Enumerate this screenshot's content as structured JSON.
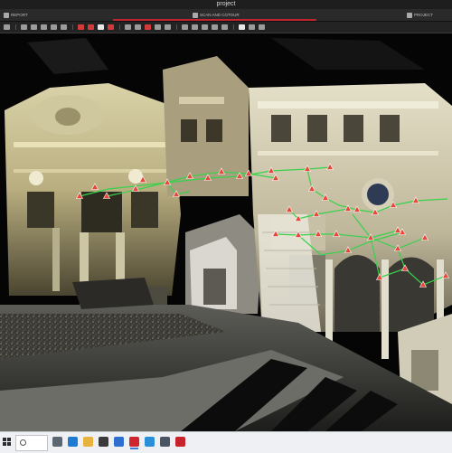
{
  "window": {
    "title": "project"
  },
  "tabs": [
    {
      "label": "REPORT",
      "icon": "document-icon"
    },
    {
      "label": "SCAN AND COTOUR",
      "icon": "scan-icon"
    },
    {
      "label": "PROJECT",
      "icon": "folder-icon"
    }
  ],
  "toolbar": {
    "buttons": [
      {
        "icon": "camera-icon",
        "style": "plain"
      },
      {
        "icon": "target-icon",
        "style": "plain"
      },
      {
        "icon": "select-icon",
        "style": "plain"
      },
      {
        "icon": "crop-icon",
        "style": "plain"
      },
      {
        "icon": "grid-icon",
        "style": "plain"
      },
      {
        "icon": "measure-icon",
        "style": "plain"
      },
      {
        "icon": "cursor-icon",
        "style": "red"
      },
      {
        "icon": "connect-icon",
        "style": "red"
      },
      {
        "icon": "sphere-icon",
        "style": "white"
      },
      {
        "icon": "link-icon",
        "style": "red"
      },
      {
        "icon": "cube-icon",
        "style": "plain"
      },
      {
        "icon": "layers-icon",
        "style": "plain"
      },
      {
        "icon": "tag-icon",
        "style": "red"
      },
      {
        "icon": "photo-icon",
        "style": "plain"
      },
      {
        "icon": "filter-icon",
        "style": "plain"
      },
      {
        "icon": "settings-icon",
        "style": "plain"
      },
      {
        "icon": "eye-icon",
        "style": "plain"
      },
      {
        "icon": "cloud-icon",
        "style": "plain"
      },
      {
        "icon": "ruler-icon",
        "style": "plain"
      },
      {
        "icon": "lock-icon",
        "style": "plain"
      },
      {
        "icon": "palette-icon",
        "style": "white"
      },
      {
        "icon": "export-icon",
        "style": "plain"
      },
      {
        "icon": "info-icon",
        "style": "plain"
      }
    ]
  },
  "viewport": {
    "scene": "point-cloud-facade",
    "marker_color": "#e8463a",
    "link_color": "#37d24c"
  },
  "taskbar": {
    "search_placeholder": "",
    "apps": [
      {
        "icon": "task-view-icon",
        "color": "#5a6672",
        "active": false
      },
      {
        "icon": "edge-browser-icon",
        "color": "#1f7bd1",
        "active": false
      },
      {
        "icon": "file-explorer-icon",
        "color": "#e7b33c",
        "active": false
      },
      {
        "icon": "store-icon",
        "color": "#3a3a3a",
        "active": false
      },
      {
        "icon": "mail-icon",
        "color": "#2f6fd0",
        "active": false
      },
      {
        "icon": "scanner-app-icon",
        "color": "#d0242f",
        "active": true
      },
      {
        "icon": "photos-icon",
        "color": "#2a8fd8",
        "active": false
      },
      {
        "icon": "monitor-icon",
        "color": "#4a5564",
        "active": false
      },
      {
        "icon": "record-icon",
        "color": "#c8232c",
        "active": false
      }
    ]
  }
}
